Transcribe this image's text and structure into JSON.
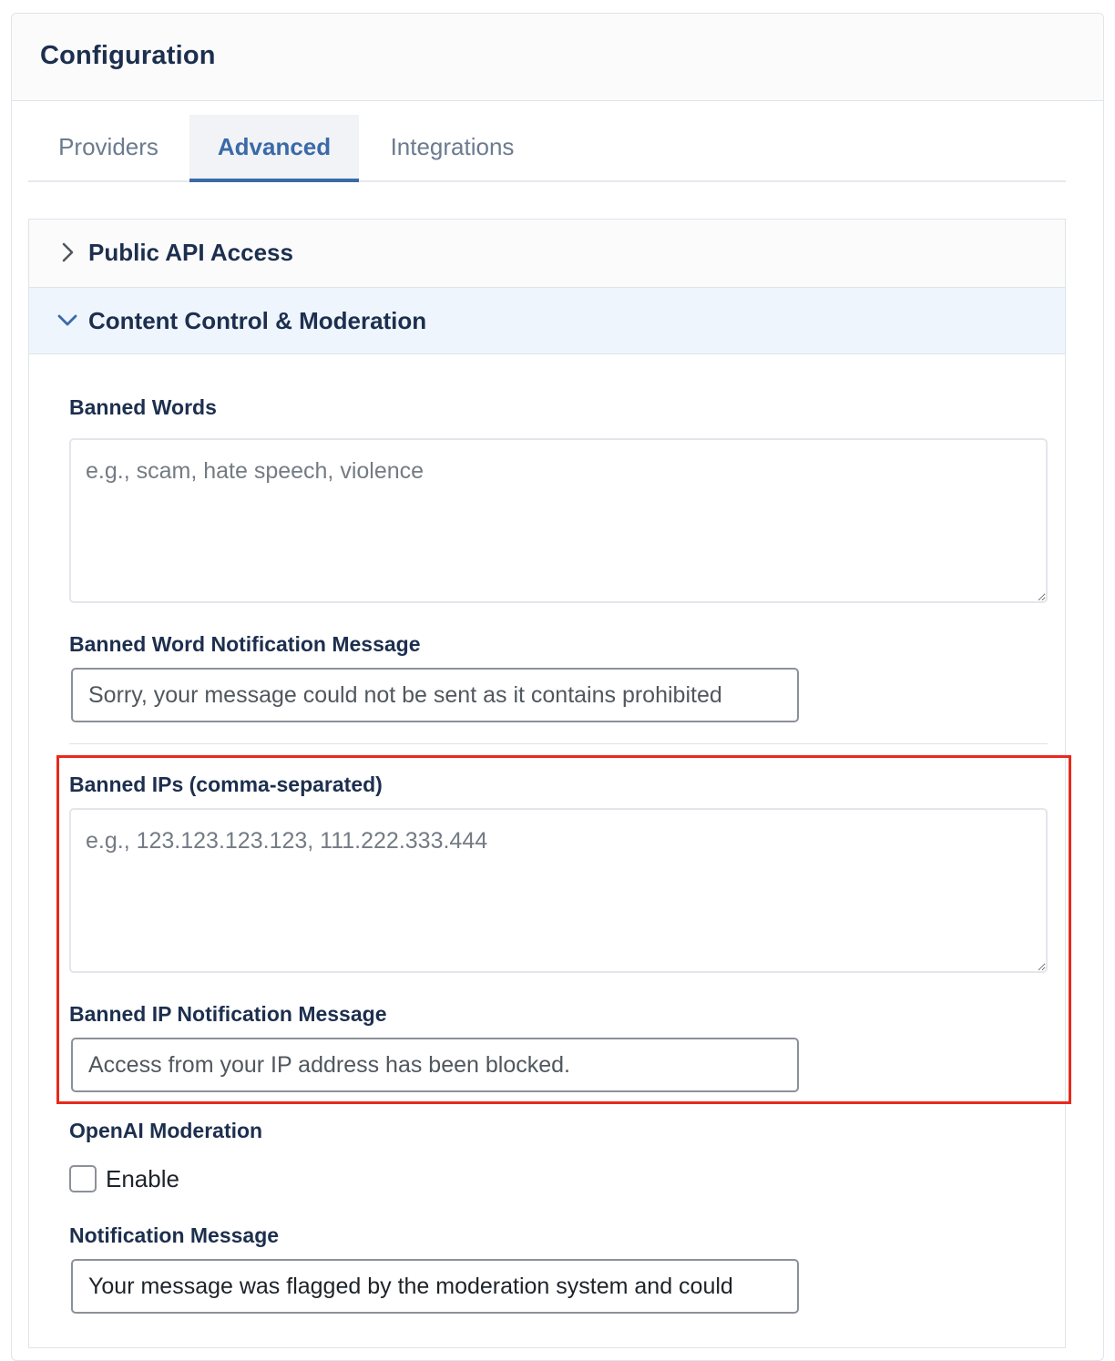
{
  "header": {
    "title": "Configuration"
  },
  "tabs": [
    {
      "label": "Providers",
      "active": false
    },
    {
      "label": "Advanced",
      "active": true
    },
    {
      "label": "Integrations",
      "active": false
    }
  ],
  "sections": {
    "public_api": {
      "label": "Public API Access",
      "expanded": false
    },
    "content_control": {
      "label": "Content Control & Moderation",
      "expanded": true
    }
  },
  "fields": {
    "banned_words": {
      "label": "Banned Words",
      "placeholder": "e.g., scam, hate speech, violence",
      "value": ""
    },
    "banned_word_message": {
      "label": "Banned Word Notification Message",
      "value": "Sorry, your message could not be sent as it contains prohibited"
    },
    "banned_ips": {
      "label": "Banned IPs (comma-separated)",
      "placeholder": "e.g., 123.123.123.123, 111.222.333.444",
      "value": ""
    },
    "banned_ip_message": {
      "label": "Banned IP Notification Message",
      "value": "Access from your IP address has been blocked."
    },
    "openai_moderation": {
      "label": "OpenAI Moderation",
      "checkbox_label": "Enable",
      "checked": false
    },
    "notification_message": {
      "label": "Notification Message",
      "value": "Your message was flagged by the moderation system and could"
    }
  },
  "colors": {
    "accent": "#3a6aa8",
    "highlight": "#e8291c",
    "text": "#1d2f4e"
  }
}
